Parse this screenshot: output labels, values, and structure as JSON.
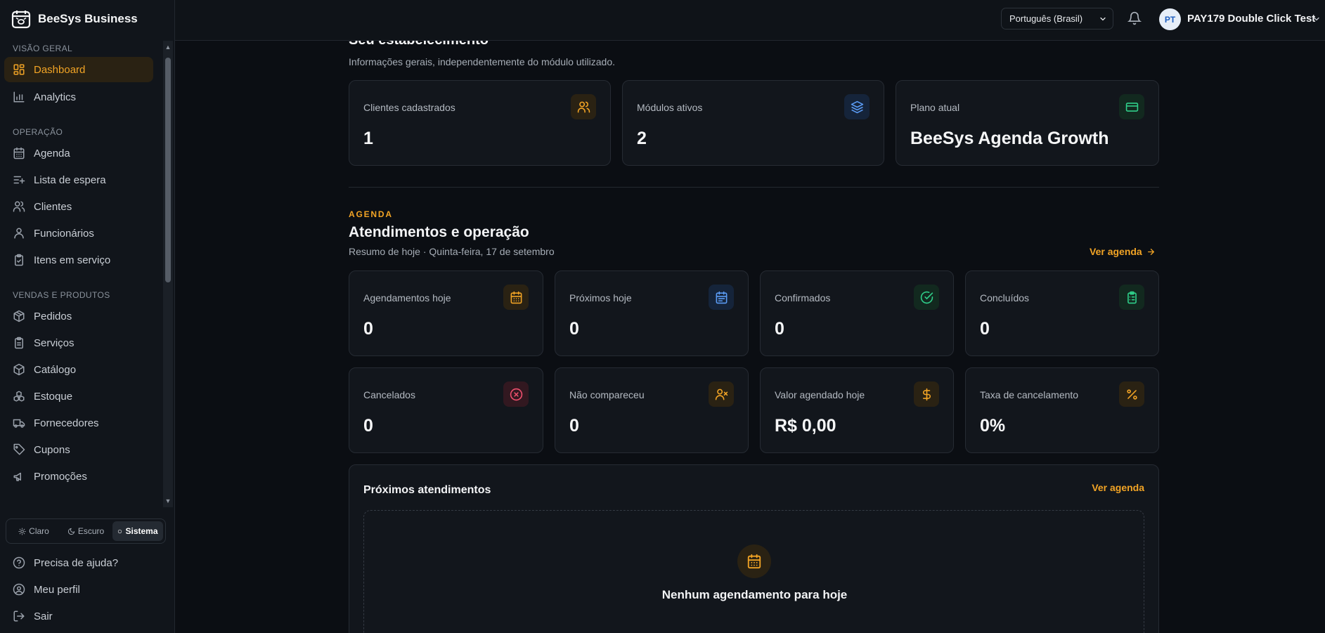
{
  "app": {
    "name": "BeeSys Business",
    "logo_icon": "calendar-bee-icon"
  },
  "sidebar": {
    "sections": [
      {
        "title": "VISÃO GERAL",
        "items": [
          {
            "label": "Dashboard",
            "icon": "dashboard-icon",
            "active": true
          },
          {
            "label": "Analytics",
            "icon": "bar-chart-icon"
          }
        ]
      },
      {
        "title": "OPERAÇÃO",
        "items": [
          {
            "label": "Agenda",
            "icon": "calendar-icon"
          },
          {
            "label": "Lista de espera",
            "icon": "list-plus-icon"
          },
          {
            "label": "Clientes",
            "icon": "users-icon"
          },
          {
            "label": "Funcionários",
            "icon": "user-icon"
          },
          {
            "label": "Itens em serviço",
            "icon": "clipboard-check-icon"
          }
        ]
      },
      {
        "title": "VENDAS E PRODUTOS",
        "items": [
          {
            "label": "Pedidos",
            "icon": "package-icon"
          },
          {
            "label": "Serviços",
            "icon": "clipboard-icon"
          },
          {
            "label": "Catálogo",
            "icon": "box-icon"
          },
          {
            "label": "Estoque",
            "icon": "boxes-icon"
          },
          {
            "label": "Fornecedores",
            "icon": "truck-icon"
          },
          {
            "label": "Cupons",
            "icon": "tag-icon"
          },
          {
            "label": "Promoções",
            "icon": "megaphone-icon"
          }
        ]
      }
    ],
    "theme": {
      "options": [
        "Claro",
        "Escuro",
        "Sistema"
      ],
      "selected": "Sistema"
    },
    "footer": [
      {
        "label": "Precisa de ajuda?",
        "icon": "help-circle-icon"
      },
      {
        "label": "Meu perfil",
        "icon": "user-circle-icon"
      },
      {
        "label": "Sair",
        "icon": "log-out-icon"
      }
    ]
  },
  "topbar": {
    "language": "Português (Brasil)",
    "user_initials": "PT",
    "user_name": "PAY179 Double Click Test"
  },
  "establishment": {
    "title": "Seu estabelecimento",
    "subtitle": "Informações gerais, independentemente do módulo utilizado.",
    "cards": [
      {
        "label": "Clientes cadastrados",
        "value": "1",
        "icon": "users-icon",
        "color": "#f2a425",
        "bg": "#2a2213"
      },
      {
        "label": "Módulos ativos",
        "value": "2",
        "icon": "layers-icon",
        "color": "#5b9cf5",
        "bg": "#15243a"
      },
      {
        "label": "Plano atual",
        "value": "BeeSys Agenda Growth",
        "icon": "credit-card-icon",
        "color": "#2fcf8a",
        "bg": "#12291f"
      }
    ]
  },
  "agenda": {
    "kicker": "AGENDA",
    "title": "Atendimentos e operação",
    "subtitle": "Resumo de hoje · Quinta-feira, 17 de setembro",
    "link": "Ver agenda",
    "cards": [
      {
        "label": "Agendamentos hoje",
        "value": "0",
        "icon": "calendar-icon",
        "color": "#f2a425",
        "bg": "#2a2213"
      },
      {
        "label": "Próximos hoje",
        "value": "0",
        "icon": "calendar-days-icon",
        "color": "#5b9cf5",
        "bg": "#15243a"
      },
      {
        "label": "Confirmados",
        "value": "0",
        "icon": "check-circle-icon",
        "color": "#2fcf8a",
        "bg": "#12291f"
      },
      {
        "label": "Concluídos",
        "value": "0",
        "icon": "clipboard-list-icon",
        "color": "#2fcf8a",
        "bg": "#12291f"
      },
      {
        "label": "Cancelados",
        "value": "0",
        "icon": "x-circle-icon",
        "color": "#f0506e",
        "bg": "#321820"
      },
      {
        "label": "Não compareceu",
        "value": "0",
        "icon": "user-x-icon",
        "color": "#f2a425",
        "bg": "#2a2213"
      },
      {
        "label": "Valor agendado hoje",
        "value": "R$ 0,00",
        "icon": "dollar-icon",
        "color": "#f2a425",
        "bg": "#2a2213"
      },
      {
        "label": "Taxa de cancelamento",
        "value": "0%",
        "icon": "percent-icon",
        "color": "#f2a425",
        "bg": "#2a2213"
      }
    ]
  },
  "upcoming": {
    "title": "Próximos atendimentos",
    "link": "Ver agenda",
    "empty_text": "Nenhum agendamento para hoje"
  }
}
